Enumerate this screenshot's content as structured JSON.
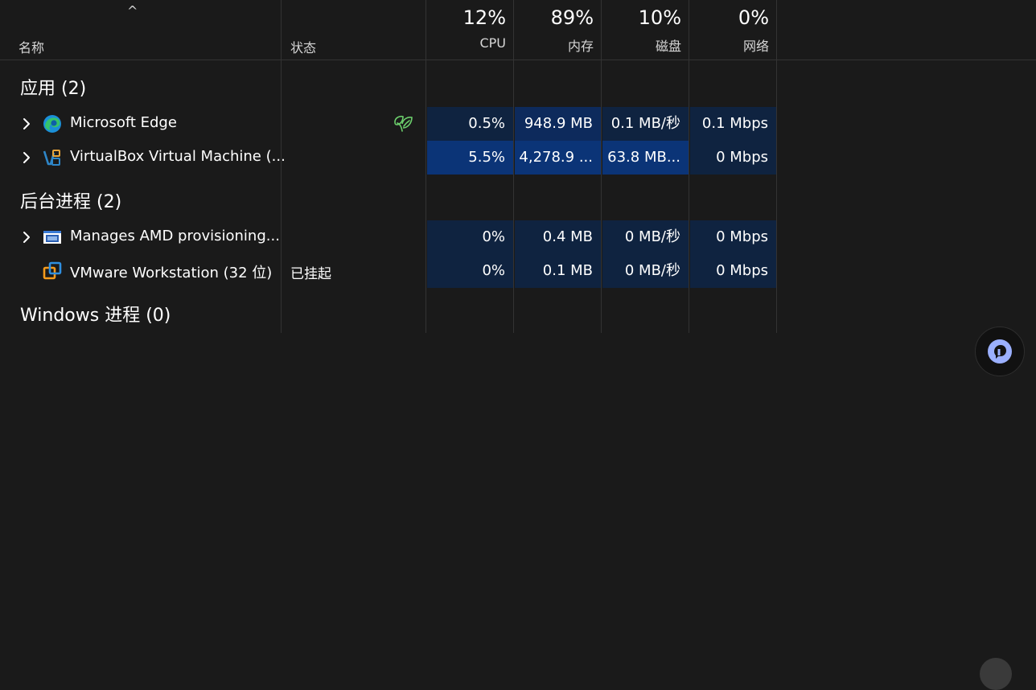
{
  "header": {
    "sort_caret": "^",
    "name_label": "名称",
    "status_label": "状态",
    "columns": [
      {
        "key": "cpu",
        "percent": "12%",
        "label": "CPU"
      },
      {
        "key": "memory",
        "percent": "89%",
        "label": "内存"
      },
      {
        "key": "disk",
        "percent": "10%",
        "label": "磁盘"
      },
      {
        "key": "network",
        "percent": "0%",
        "label": "网络"
      }
    ]
  },
  "groups": {
    "apps": {
      "title": "应用 (2)"
    },
    "background": {
      "title": "后台进程 (2)"
    },
    "windows": {
      "title": "Windows 进程 (0)"
    }
  },
  "rows": [
    {
      "name": "Microsoft Edge",
      "status": "",
      "icon": "edge-icon",
      "status_icon": "leaf-icon",
      "cpu": "0.5%",
      "memory": "948.9 MB",
      "disk": "0.1 MB/秒",
      "network": "0.1 Mbps"
    },
    {
      "name": "VirtualBox Virtual Machine (...",
      "status": "",
      "icon": "virtualbox-icon",
      "cpu": "5.5%",
      "memory": "4,278.9 ...",
      "disk": "63.8 MB...",
      "network": "0 Mbps"
    },
    {
      "name": "Manages AMD provisioning...",
      "status": "",
      "icon": "window-app-icon",
      "cpu": "0%",
      "memory": "0.4 MB",
      "disk": "0 MB/秒",
      "network": "0 Mbps"
    },
    {
      "name": "VMware Workstation (32 位)",
      "status": "已挂起",
      "icon": "vmware-icon",
      "cpu": "0%",
      "memory": "0.1 MB",
      "disk": "0 MB/秒",
      "network": "0 Mbps"
    }
  ],
  "colors": {
    "background": "#1a1a1a",
    "heat_light": "#0f2340",
    "heat_mid": "#0d2a5c",
    "heat_strong": "#0b3477",
    "eco_leaf": "#6ccf6c"
  }
}
